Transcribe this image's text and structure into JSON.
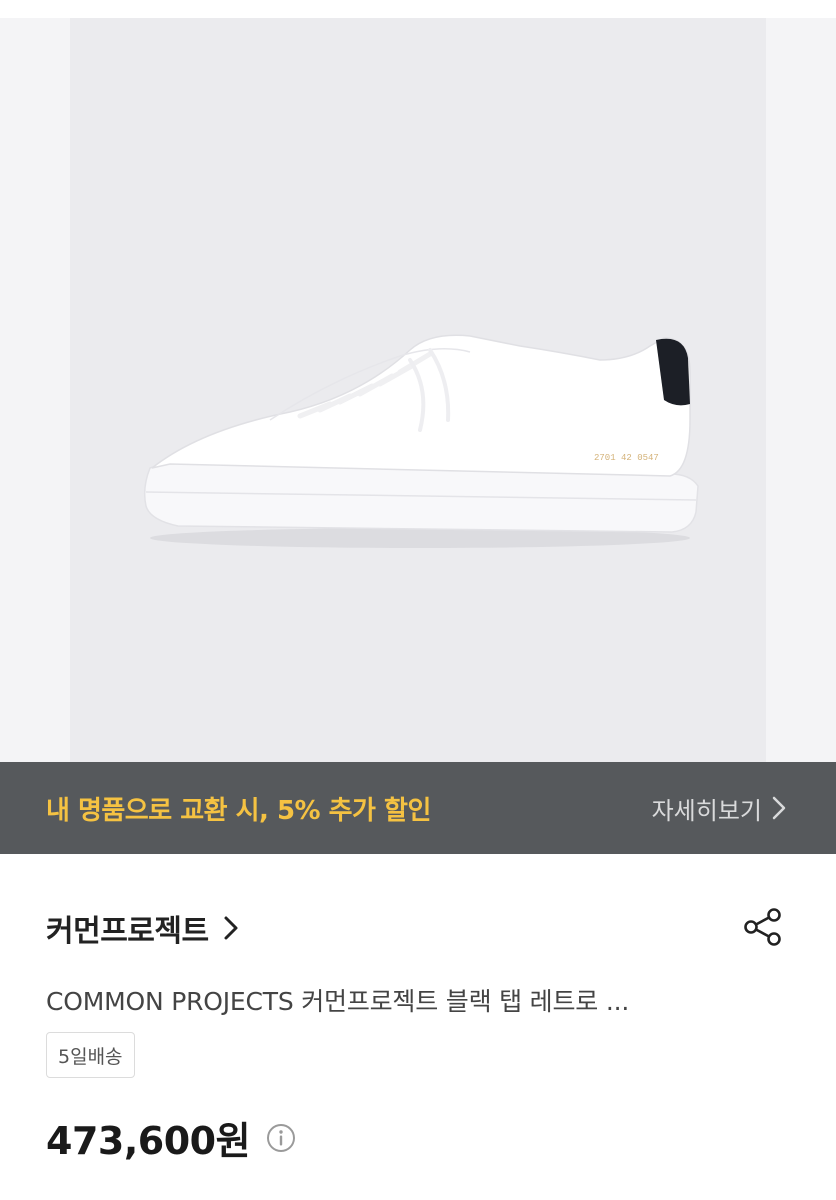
{
  "promo": {
    "text": "내 명품으로 교환 시, 5% 추가 할인",
    "link_label": "자세히보기",
    "link_icon": "chevron-right-icon"
  },
  "product": {
    "brand": "커먼프로젝트",
    "brand_icon": "chevron-right-icon",
    "share_icon": "share-icon",
    "title": "COMMON PROJECTS 커먼프로젝트 블랙 탭 레트로 ...",
    "shipping_badge": "5일배송",
    "price": "473,600원",
    "price_info_icon": "info-icon"
  },
  "colors": {
    "promo_bg": "#56595c",
    "promo_accent": "#f5c242",
    "photo_bg": "#ebebee"
  }
}
